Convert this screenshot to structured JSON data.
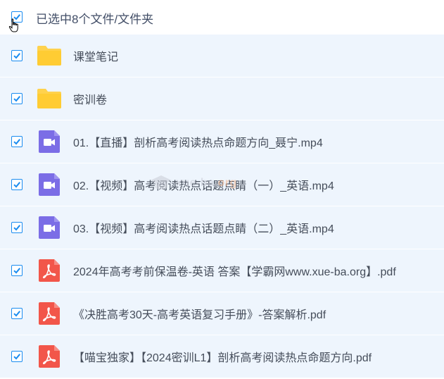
{
  "selection": {
    "summary": "已选中8个文件/文件夹"
  },
  "colors": {
    "row_background": "#eef5fd",
    "checkbox": "#1a8cf0",
    "folder": "#ffd24d",
    "video": "#7b6de6",
    "pdf": "#f2564a"
  },
  "files": [
    {
      "name": "课堂笔记",
      "type": "folder",
      "icon": "folder-icon",
      "checked": true
    },
    {
      "name": "密训卷",
      "type": "folder",
      "icon": "folder-icon",
      "checked": true
    },
    {
      "name": "01.【直播】剖析高考阅读热点命题方向_聂宁.mp4",
      "type": "video",
      "icon": "video-file-icon",
      "checked": true
    },
    {
      "name": "02.【视频】高考阅读热点话题点睛（一）_英语.mp4",
      "type": "video",
      "icon": "video-file-icon",
      "checked": true
    },
    {
      "name": "03.【视频】高考阅读热点话题点睛（二）_英语.mp4",
      "type": "video",
      "icon": "video-file-icon",
      "checked": true
    },
    {
      "name": "2024年高考考前保温卷-英语 答案【学霸网www.xue-ba.org】.pdf",
      "type": "pdf",
      "icon": "pdf-file-icon",
      "checked": true
    },
    {
      "name": "《决胜高考30天-高考英语复习手册》-答案解析.pdf",
      "type": "pdf",
      "icon": "pdf-file-icon",
      "checked": true
    },
    {
      "name": "【喵宝独家】【2024密训L1】剖析高考阅读热点命题方向.pdf",
      "type": "pdf",
      "icon": "pdf-file-icon",
      "checked": true
    }
  ],
  "watermark": {
    "text": "xue-ba.org",
    "icon": "graduation-cap-icon"
  }
}
